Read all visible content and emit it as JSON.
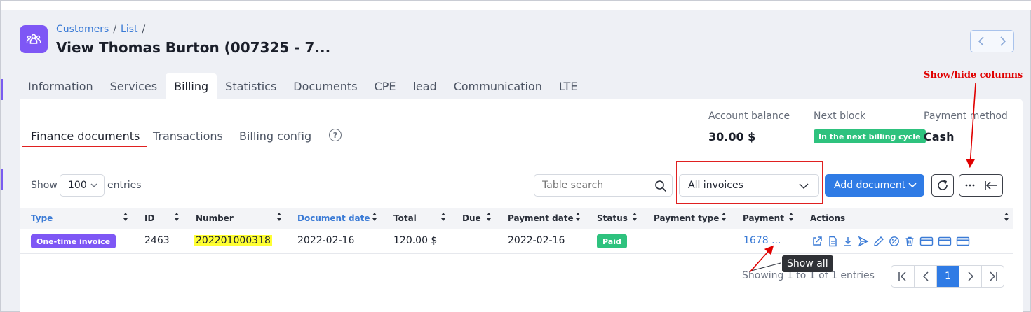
{
  "breadcrumb": {
    "item1": "Customers",
    "sep1": "/",
    "item2": "List",
    "sep2": "/"
  },
  "page_title": "View Thomas Burton (007325 - 7...",
  "tabs": [
    {
      "label": "Information"
    },
    {
      "label": "Services"
    },
    {
      "label": "Billing"
    },
    {
      "label": "Statistics"
    },
    {
      "label": "Documents"
    },
    {
      "label": "CPE"
    },
    {
      "label": "lead"
    },
    {
      "label": "Communication"
    },
    {
      "label": "LTE"
    }
  ],
  "subtabs": {
    "finance": "Finance documents",
    "transactions": "Transactions",
    "config": "Billing config",
    "help": "?"
  },
  "summary": {
    "balance_label": "Account balance",
    "balance_value": "30.00 $",
    "next_block_label": "Next block",
    "next_block_value": "In the next billing cycle",
    "payment_method_label": "Payment method",
    "payment_method_value": "Cash"
  },
  "annotation": "Show/hide columns",
  "controls": {
    "show_label": "Show",
    "entries_value": "100",
    "entries_label": "entries",
    "search_placeholder": "Table search",
    "filter_value": "All invoices",
    "add_label": "Add document"
  },
  "table": {
    "headers": [
      "Type",
      "ID",
      "Number",
      "Document date",
      "Total",
      "Due",
      "Payment date",
      "Status",
      "Payment type",
      "Payment",
      "Actions"
    ],
    "rows": [
      {
        "type": "One-time invoice",
        "id": "2463",
        "number": "202201000318",
        "document_date": "2022-02-16",
        "total": "120.00 $",
        "due": "",
        "payment_date": "2022-02-16",
        "status": "Paid",
        "payment_type": "",
        "payment": "1678 ..."
      }
    ]
  },
  "tooltip": "Show all",
  "footer": {
    "showing": "Showing 1 to 1 of 1 entries",
    "current_page": "1"
  },
  "colors": {
    "accent": "#2f7be5",
    "brand": "#7e57f5",
    "success": "#2ec27e",
    "annotation": "#e00000",
    "highlight": "#ffff33"
  }
}
